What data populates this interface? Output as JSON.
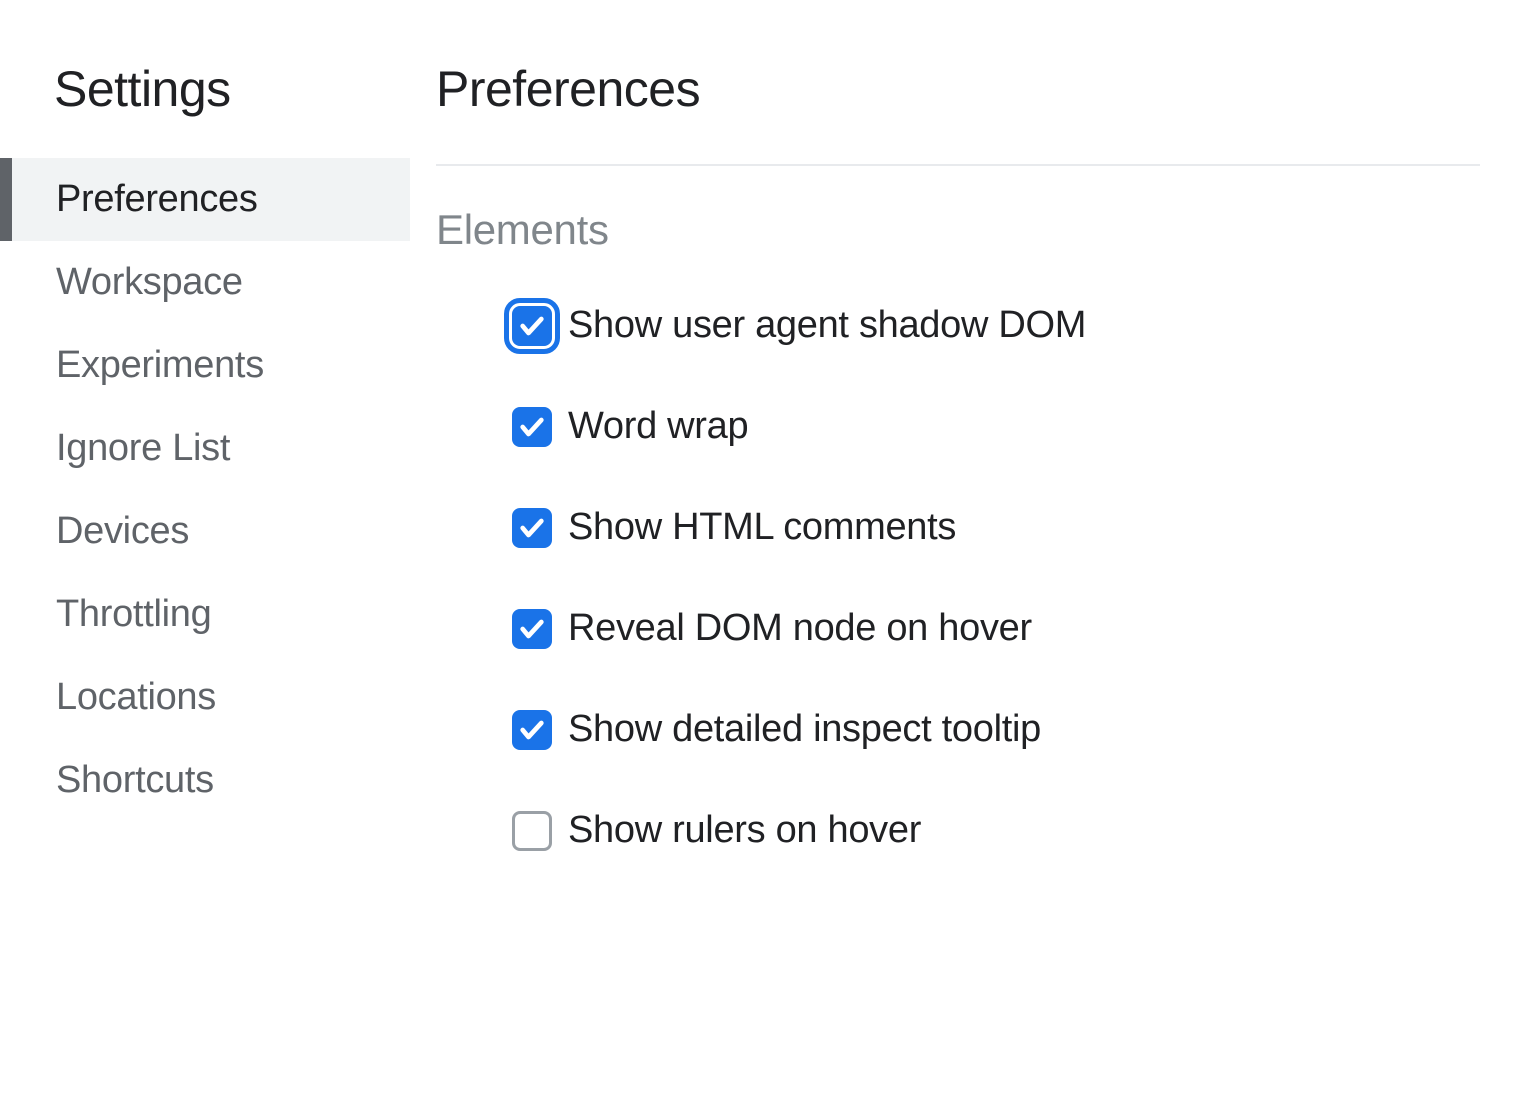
{
  "sidebar": {
    "title": "Settings",
    "items": [
      {
        "label": "Preferences",
        "selected": true
      },
      {
        "label": "Workspace",
        "selected": false
      },
      {
        "label": "Experiments",
        "selected": false
      },
      {
        "label": "Ignore List",
        "selected": false
      },
      {
        "label": "Devices",
        "selected": false
      },
      {
        "label": "Throttling",
        "selected": false
      },
      {
        "label": "Locations",
        "selected": false
      },
      {
        "label": "Shortcuts",
        "selected": false
      }
    ]
  },
  "main": {
    "title": "Preferences",
    "section": {
      "heading": "Elements",
      "options": [
        {
          "label": "Show user agent shadow DOM",
          "checked": true,
          "focused": true
        },
        {
          "label": "Word wrap",
          "checked": true,
          "focused": false
        },
        {
          "label": "Show HTML comments",
          "checked": true,
          "focused": false
        },
        {
          "label": "Reveal DOM node on hover",
          "checked": true,
          "focused": false
        },
        {
          "label": "Show detailed inspect tooltip",
          "checked": true,
          "focused": false
        },
        {
          "label": "Show rulers on hover",
          "checked": false,
          "focused": false
        }
      ]
    }
  }
}
